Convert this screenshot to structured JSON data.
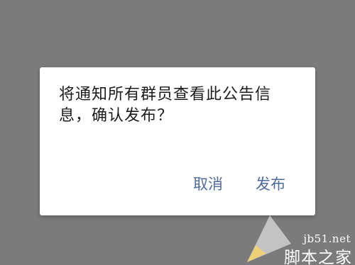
{
  "dialog": {
    "message": "将通知所有群员查看此公告信息，确认发布？",
    "cancel_label": "取消",
    "confirm_label": "发布"
  },
  "watermark": {
    "url": "jb51.net",
    "site_name": "脚本之家"
  },
  "colors": {
    "overlay": "#7b7b7b",
    "dialog_bg": "#ffffff",
    "button_text": "#4e6b9c",
    "message_text": "#1c1c1c"
  }
}
